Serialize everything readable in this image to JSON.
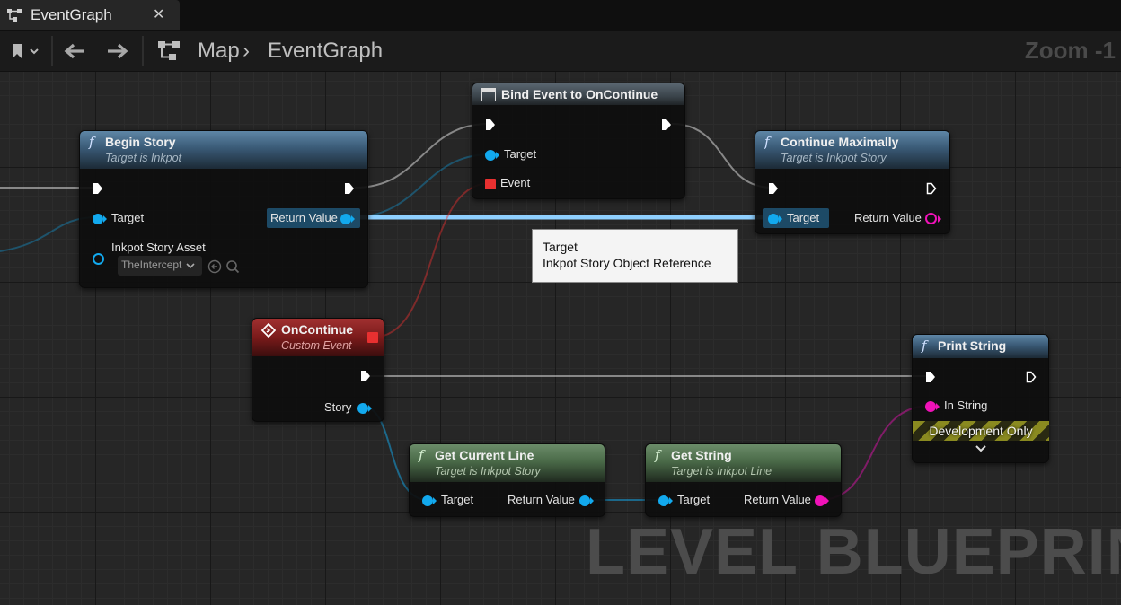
{
  "tab": {
    "label": "EventGraph",
    "close": "✕"
  },
  "toolbar": {
    "breadcrumb_root": "Map",
    "breadcrumb_separator": "›",
    "breadcrumb_current": "EventGraph",
    "zoom": "Zoom -1"
  },
  "nodes": {
    "begin_story": {
      "title": "Begin Story",
      "subtitle": "Target is Inkpot",
      "target": "Target",
      "return_value": "Return Value",
      "asset_label": "Inkpot Story Asset",
      "asset_value": "TheIntercept"
    },
    "bind_event": {
      "title": "Bind Event to OnContinue",
      "target": "Target",
      "event": "Event"
    },
    "continue_max": {
      "title": "Continue Maximally",
      "subtitle": "Target is Inkpot Story",
      "target": "Target",
      "return_value": "Return Value"
    },
    "on_continue": {
      "title": "OnContinue",
      "subtitle": "Custom Event",
      "story": "Story"
    },
    "print_string": {
      "title": "Print String",
      "in_string": "In String",
      "dev_only": "Development Only"
    },
    "get_current_line": {
      "title": "Get Current Line",
      "subtitle": "Target is Inkpot Story",
      "target": "Target",
      "return_value": "Return Value"
    },
    "get_string": {
      "title": "Get String",
      "subtitle": "Target is Inkpot Line",
      "target": "Target",
      "return_value": "Return Value"
    }
  },
  "tooltip": {
    "line1": "Target",
    "line2": "Inkpot Story Object Reference"
  },
  "watermark": "LEVEL BLUEPRINT",
  "colors": {
    "object_pin": "#12a9ee",
    "string_pin": "#f012b8",
    "delegate_pin": "#e83030",
    "function_header": "#3a5a76",
    "pure_header": "#4a6a48",
    "event_header": "#7a1a1a"
  }
}
